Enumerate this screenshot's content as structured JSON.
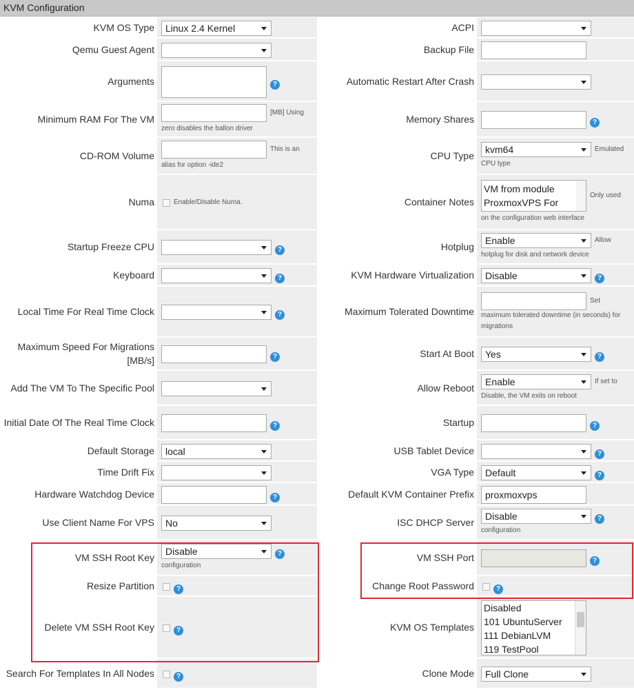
{
  "title": "KVM Configuration",
  "rows": [
    {
      "left": {
        "label": "KVM OS Type",
        "select": "Linux 2.4 Kernel"
      },
      "right": {
        "label": "ACPI",
        "select": ""
      }
    },
    {
      "left": {
        "label": "Qemu Guest Agent",
        "select": ""
      },
      "right": {
        "label": "Backup File",
        "input": ""
      }
    },
    {
      "left": {
        "label": "Arguments"
      },
      "right": {
        "label": "Automatic Restart After Crash",
        "select": ""
      }
    },
    {
      "left": {
        "label": "Minimum RAM For The VM",
        "unit": "[MB] Using",
        "hint": "zero disables the ballon driver"
      },
      "right": {
        "label": "Memory Shares"
      }
    },
    {
      "left": {
        "label": "CD-ROM Volume",
        "unit": "This is an",
        "hint": "alias for option -ide2"
      },
      "right": {
        "label": "CPU Type",
        "select": "kvm64",
        "unit": "Emulated",
        "hint": "CPU type"
      }
    },
    {
      "left": {
        "label": "Numa",
        "checkbox_label": "Enable/Disable Numa."
      },
      "right": {
        "label": "Container Notes",
        "text": "VM from module ProxmoxVPS For",
        "unit": "Only used",
        "hint": "on the configuration web interface"
      }
    },
    {
      "left": {
        "label": "Startup Freeze CPU",
        "select": ""
      },
      "right": {
        "label": "Hotplug",
        "select": "Enable",
        "unit": "Allow",
        "hint": "hotplug for disk and network device"
      }
    },
    {
      "left": {
        "label": "Keyboard",
        "select": ""
      },
      "right": {
        "label": "KVM Hardware Virtualization",
        "select": "Disable"
      }
    },
    {
      "left": {
        "label": "Local Time For Real Time Clock",
        "select": ""
      },
      "right": {
        "label": "Maximum Tolerated Downtime",
        "unit": "Set",
        "hint": "maximum tolerated downtime (in seconds) for migrations"
      }
    },
    {
      "left": {
        "label": "Maximum Speed For Migrations [MB/s]"
      },
      "right": {
        "label": "Start At Boot",
        "select": "Yes"
      }
    },
    {
      "left": {
        "label": "Add The VM To The Specific Pool",
        "select": ""
      },
      "right": {
        "label": "Allow Reboot",
        "select": "Enable",
        "unit": "If set to",
        "hint": "Disable, the VM exits on reboot"
      }
    },
    {
      "left": {
        "label": "Initial Date Of The Real Time Clock"
      },
      "right": {
        "label": "Startup"
      }
    },
    {
      "left": {
        "label": "Default Storage",
        "select": "local"
      },
      "right": {
        "label": "USB Tablet Device",
        "select": ""
      }
    },
    {
      "left": {
        "label": "Time Drift Fix",
        "select": ""
      },
      "right": {
        "label": "VGA Type",
        "select": "Default"
      }
    },
    {
      "left": {
        "label": "Hardware Watchdog Device"
      },
      "right": {
        "label": "Default KVM Container Prefix",
        "input": "proxmoxvps"
      }
    },
    {
      "left": {
        "label": "Use Client Name For VPS",
        "select": "No"
      },
      "right": {
        "label": "ISC DHCP Server",
        "select": "Disable",
        "hint": "configuration"
      }
    },
    {
      "left": {
        "label": "VM SSH Root Key",
        "select": "Disable",
        "hint": "configuration"
      },
      "right": {
        "label": "VM SSH Port"
      }
    },
    {
      "left": {
        "label": "Resize Partition"
      },
      "right": {
        "label": "Change Root Password"
      }
    },
    {
      "left": {
        "label": "Delete VM SSH Root Key"
      },
      "right": {
        "label": "KVM OS Templates",
        "options": [
          "Disabled",
          "101 UbuntuServer",
          "111 DebianLVM",
          "119 TestPool"
        ]
      }
    },
    {
      "left": {
        "label": "Search For Templates In All Nodes"
      },
      "right": {
        "label": "Clone Mode",
        "select": "Full Clone"
      }
    }
  ],
  "help_glyph": "?",
  "colors": {
    "highlight_border": "#e0282e",
    "help_icon": "#2f8fd6",
    "field_bg": "#eeeeee",
    "title_bg": "#c8c8c8"
  }
}
